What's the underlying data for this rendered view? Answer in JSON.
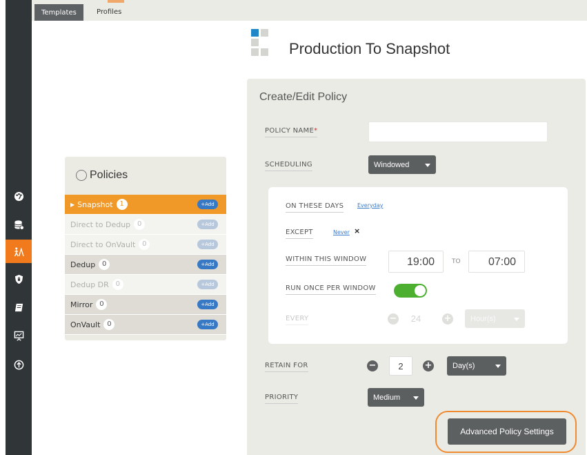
{
  "tabs": {
    "templates": "Templates",
    "profiles": "Profiles"
  },
  "sidebar": {
    "icons": [
      "dashboard-icon",
      "database-icon",
      "sla-architect-icon",
      "shield-icon",
      "book-icon",
      "monitor-icon",
      "upload-icon"
    ],
    "active_color": "#f07a1c"
  },
  "policies": {
    "title": "Policies",
    "items": [
      {
        "label": "Snapshot",
        "count": "1",
        "add": "+Add",
        "state": "active"
      },
      {
        "label": "Direct to Dedup",
        "count": "0",
        "add": "+Add",
        "state": "dim"
      },
      {
        "label": "Direct to OnVault",
        "count": "0",
        "add": "+Add",
        "state": "dim"
      },
      {
        "label": "Dedup",
        "count": "0",
        "add": "+Add",
        "state": "normal"
      },
      {
        "label": "Dedup DR",
        "count": "0",
        "add": "+Add",
        "state": "dim"
      },
      {
        "label": "Mirror",
        "count": "0",
        "add": "+Add",
        "state": "normal"
      },
      {
        "label": "OnVault",
        "count": "0",
        "add": "+Add",
        "state": "normal"
      }
    ]
  },
  "page_title": "Production To Snapshot",
  "form": {
    "heading": "Create/Edit Policy",
    "policy_name_label": "POLICY NAME",
    "policy_name_required": "*",
    "policy_name_value": "",
    "scheduling_label": "SCHEDULING",
    "scheduling_value": "Windowed",
    "on_these_days_label": "ON THESE DAYS",
    "on_these_days_value": "Everyday",
    "except_label": "EXCEPT",
    "except_value": "Never",
    "except_clear": "×",
    "window_label": "WITHIN THIS WINDOW",
    "window_start": "19:00",
    "window_to": "TO",
    "window_end": "07:00",
    "run_once_label": "RUN ONCE PER WINDOW",
    "run_once_on": true,
    "every_label": "EVERY",
    "every_value": "24",
    "every_unit": "Hour(s)",
    "retain_label": "RETAIN FOR",
    "retain_value": "2",
    "retain_unit": "Day(s)",
    "priority_label": "PRIORITY",
    "priority_value": "Medium",
    "minus": "−",
    "plus": "+",
    "advanced_button": "Advanced Policy Settings"
  },
  "colors": {
    "accent_orange": "#f09828",
    "toggle_green": "#4caf2f",
    "link_blue": "#3b7bcb",
    "add_blue": "#3879c6"
  }
}
